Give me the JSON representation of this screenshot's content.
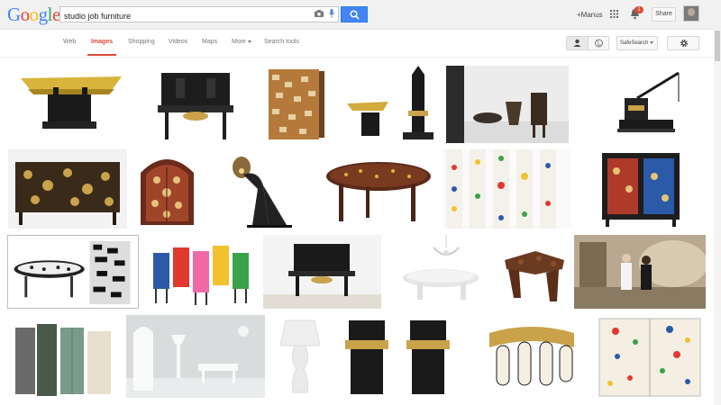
{
  "header": {
    "logo_letters": [
      {
        "ch": "G",
        "color": "#4285f4"
      },
      {
        "ch": "o",
        "color": "#ea4335"
      },
      {
        "ch": "o",
        "color": "#fbbc05"
      },
      {
        "ch": "g",
        "color": "#4285f4"
      },
      {
        "ch": "l",
        "color": "#34a853"
      },
      {
        "ch": "e",
        "color": "#ea4335"
      }
    ],
    "search_value": "studio job furniture",
    "user_link": "+Manus",
    "notification_count": "1",
    "share_label": "Share"
  },
  "nav": {
    "tabs": [
      {
        "label": "Web",
        "active": false
      },
      {
        "label": "Images",
        "active": true
      },
      {
        "label": "Shopping",
        "active": false
      },
      {
        "label": "Videos",
        "active": false
      },
      {
        "label": "Maps",
        "active": false
      },
      {
        "label": "More",
        "active": false
      },
      {
        "label": "Search tools",
        "active": false
      }
    ],
    "safesearch_label": "SafeSearch"
  },
  "colors": {
    "accent_red": "#dd4b39",
    "search_blue": "#4285f4"
  },
  "results": [
    {
      "name": "gold-table-house"
    },
    {
      "name": "black-cabinet-table"
    },
    {
      "name": "gold-pattern-cabinet"
    },
    {
      "name": "tower-table-set"
    },
    {
      "name": "gallery-chairs"
    },
    {
      "name": "crane-sculpture"
    },
    {
      "name": "wide-pattern-cabinet"
    },
    {
      "name": "arched-cabinet"
    },
    {
      "name": "eiffel-lamp"
    },
    {
      "name": "mosaic-oval-table"
    },
    {
      "name": "painted-panels"
    },
    {
      "name": "colorful-wardrobe"
    },
    {
      "name": "bw-table-cabinet"
    },
    {
      "name": "colored-chairs"
    },
    {
      "name": "black-console-table"
    },
    {
      "name": "white-chandelier-table"
    },
    {
      "name": "brown-rock-table"
    },
    {
      "name": "people-gallery"
    },
    {
      "name": "locker-cabinets"
    },
    {
      "name": "white-room"
    },
    {
      "name": "white-table-lamp"
    },
    {
      "name": "black-gold-towers"
    },
    {
      "name": "key-shaped-object"
    },
    {
      "name": "painted-cabinet"
    }
  ]
}
